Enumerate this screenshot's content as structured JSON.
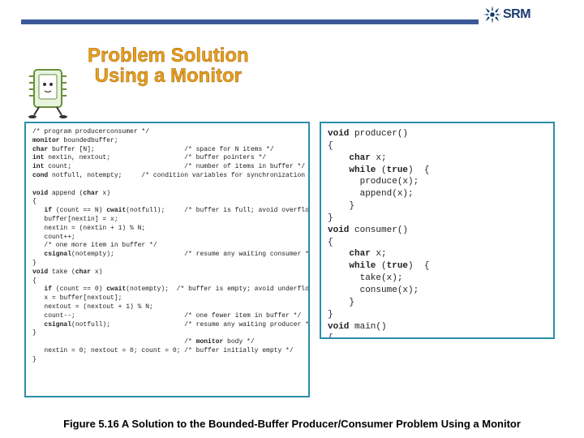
{
  "logo": {
    "text": "SRM"
  },
  "title": {
    "line1": "Problem Solution",
    "line2": "Using a Monitor"
  },
  "code_left": "/* program producerconsumer */\nmonitor boundedbuffer;\nchar buffer [N];                       /* space for N items */\nint nextin, nextout;                   /* buffer pointers */\nint count;                             /* number of items in buffer */\ncond notfull, notempty;     /* condition variables for synchronization */\n\nvoid append (char x)\n{\n   if (count == N) cwait(notfull);     /* buffer is full; avoid overflow */\n   buffer[nextin] = x;\n   nextin = (nextin + 1) % N;\n   count++;\n   /* one more item in buffer */\n   csignal(notempty);                  /* resume any waiting consumer */\n}\nvoid take (char x)\n{\n   if (count == 0) cwait(notempty);  /* buffer is empty; avoid underflow */\n   x = buffer[nextout];\n   nextout = (nextout + 1) % N;\n   count--;                            /* one fewer item in buffer */\n   csignal(notfull);                   /* resume any waiting producer */\n}\n                                       /* monitor body */\n   nextin = 0; nextout = 0; count = 0; /* buffer initially empty */\n}",
  "code_right": "void producer()\n{\n    char x;\n    while (true)  {\n      produce(x);\n      append(x);\n    }\n}\nvoid consumer()\n{\n    char x;\n    while (true)  {\n      take(x);\n      consume(x);\n    }\n}\nvoid main()\n{\n    parbegin (producer, consumer);\n}",
  "caption": "Figure 5.16  A Solution to the Bounded-Buffer Producer/Consumer Problem Using a Monitor"
}
